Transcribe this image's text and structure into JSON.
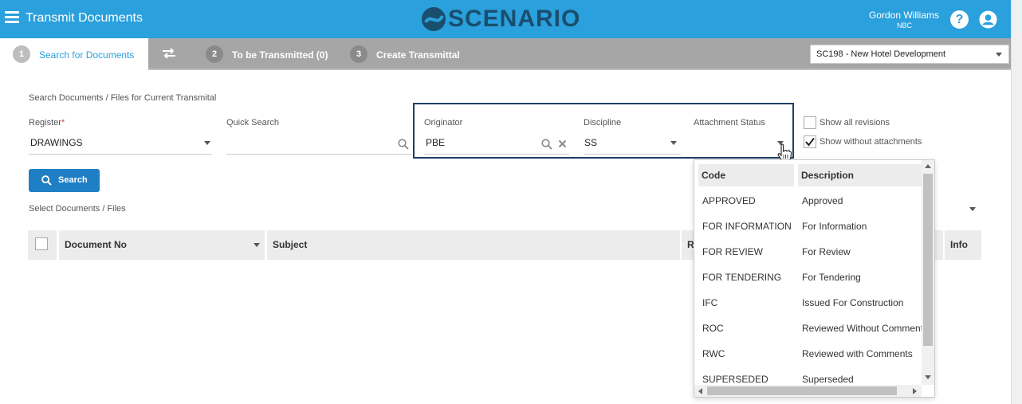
{
  "header": {
    "title": "Transmit Documents",
    "logo_text": "SCENARIO",
    "user_name": "Gordon Williams",
    "user_org": "NBC",
    "help_glyph": "?",
    "icons": [
      "menu-icon",
      "scenario-logo-icon",
      "help-icon",
      "user-icon"
    ],
    "accent_color": "#2aa0dc"
  },
  "steps": [
    {
      "num": "1",
      "label": "Search for Documents"
    },
    {
      "num": "2",
      "label": "To be Transmitted (0)"
    },
    {
      "num": "3",
      "label": "Create Transmittal"
    }
  ],
  "project_select": {
    "value": "SC198  -  New Hotel Development"
  },
  "form": {
    "section_title": "Search Documents / Files for Current Transmital",
    "register_label": "Register",
    "register_required": "*",
    "register_value": "DRAWINGS",
    "quick_search_label": "Quick Search",
    "quick_search_value": "",
    "originator_label": "Originator",
    "originator_value": "PBE",
    "discipline_label": "Discipline",
    "discipline_value": "SS",
    "attachment_status_label": "Attachment Status",
    "attachment_status_value": "",
    "show_all_revisions": {
      "label": "Show all revisions",
      "checked": false
    },
    "show_without_attachments": {
      "label": "Show without attachments",
      "checked": true
    },
    "search_button": "Search",
    "select_title": "Select Documents / Files"
  },
  "table": {
    "columns": [
      "Document No",
      "Subject",
      "R",
      "Info"
    ]
  },
  "dropdown": {
    "headers": [
      "Code",
      "Description"
    ],
    "rows": [
      {
        "code": "APPROVED",
        "desc": "Approved"
      },
      {
        "code": "FOR INFORMATION",
        "desc": "For Information"
      },
      {
        "code": "FOR REVIEW",
        "desc": "For Review"
      },
      {
        "code": "FOR TENDERING",
        "desc": "For Tendering"
      },
      {
        "code": "IFC",
        "desc": "Issued For Construction"
      },
      {
        "code": "ROC",
        "desc": "Reviewed Without Comments"
      },
      {
        "code": "RWC",
        "desc": "Reviewed with Comments"
      },
      {
        "code": "SUPERSEDED",
        "desc": "Superseded"
      }
    ]
  }
}
